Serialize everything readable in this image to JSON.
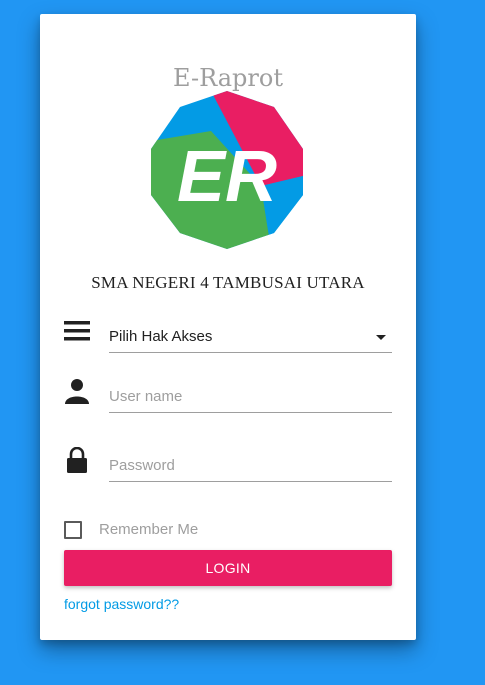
{
  "app_title": "E-Raprot",
  "logo": {
    "text": "ER",
    "colors": [
      "#039be5",
      "#e91e63",
      "#4caf50"
    ]
  },
  "school_name": "SMA NEGERI 4 TAMBUSAI UTARA",
  "access_select": {
    "value": "Pilih Hak Akses",
    "icon": "menu-icon"
  },
  "username": {
    "placeholder": "User name",
    "icon": "person-icon"
  },
  "password": {
    "placeholder": "Password",
    "icon": "lock-icon"
  },
  "remember": {
    "label": "Remember Me",
    "checked": false
  },
  "login_label": "LOGIN",
  "forgot_label": "forgot password??",
  "colors": {
    "background": "#2196f3",
    "button": "#e91e63",
    "link": "#039be5"
  }
}
